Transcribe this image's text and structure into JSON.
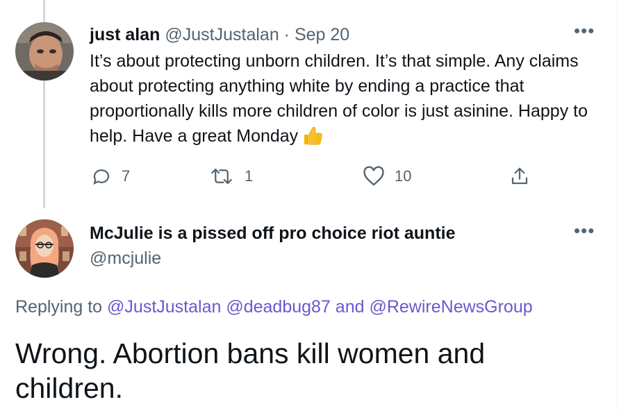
{
  "tweet1": {
    "author_name": "just alan",
    "handle": "@JustJustalan",
    "separator": "·",
    "date": "Sep 20",
    "text": "It’s about protecting unborn children. It’s that simple. Any claims about protecting anything white by ending a practice that proportionally kills more children of color is just asinine. Happy to help. Have a great Monday",
    "emoji_icon": "thumbs-up-icon",
    "more_label": "•••",
    "actions": {
      "reply_count": "7",
      "retweet_count": "1",
      "like_count": "10"
    }
  },
  "tweet2": {
    "author_name": "McJulie is a pissed off pro choice riot auntie",
    "handle": "@mcjulie",
    "more_label": "•••",
    "replying_prefix": "Replying to",
    "mentions": [
      "@JustJustalan",
      "@deadbug87"
    ],
    "and_word": "and",
    "mention_last": "@RewireNewsGroup",
    "text": "Wrong. Abortion bans kill women and children."
  },
  "colors": {
    "text": "#0f1419",
    "muted": "#536471",
    "link": "#6e56cf",
    "thread_line": "#cfd9de"
  }
}
